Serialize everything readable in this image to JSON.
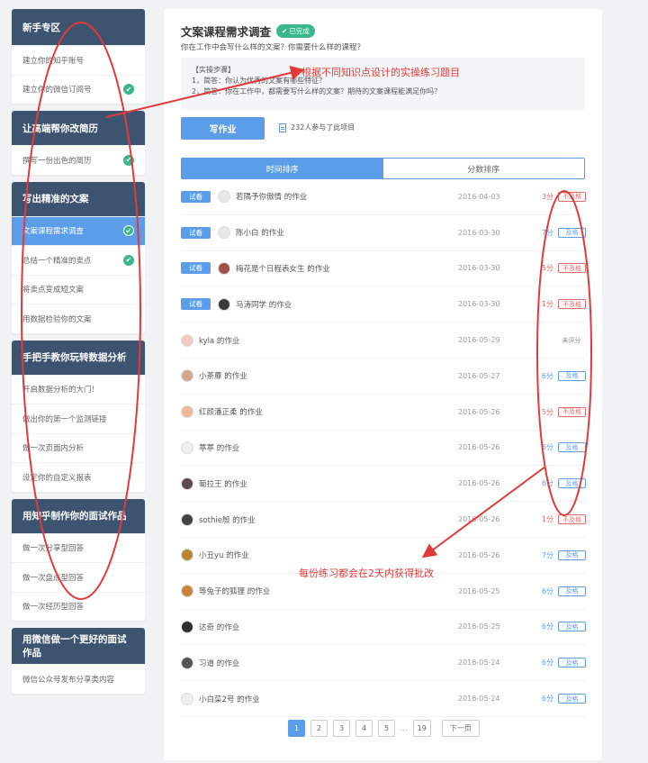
{
  "sidebar": [
    {
      "title": "新手专区",
      "items": [
        {
          "label": "建立你的知乎账号",
          "done": false
        },
        {
          "label": "建立你的微信订阅号",
          "done": true
        }
      ]
    },
    {
      "title": "让高端帮你改简历",
      "items": [
        {
          "label": "撰写一份出色的简历",
          "done": true
        }
      ]
    },
    {
      "title": "写出精准的文案",
      "items": [
        {
          "label": "文案课程需求调查",
          "done": true,
          "active": true
        },
        {
          "label": "总结一个精准的卖点",
          "done": true
        },
        {
          "label": "将卖点变成短文案",
          "done": false
        },
        {
          "label": "用数据检验你的文案",
          "done": false
        }
      ]
    },
    {
      "title": "手把手教你玩转数据分析",
      "items": [
        {
          "label": "开启数据分析的大门！",
          "done": false
        },
        {
          "label": "做出你的第一个监测链接",
          "done": false
        },
        {
          "label": "做一次页面内分析",
          "done": false
        },
        {
          "label": "设定你的自定义报表",
          "done": false
        }
      ]
    },
    {
      "title": "用知乎制作你的面试作品",
      "items": [
        {
          "label": "做一次分享型回答",
          "done": false
        },
        {
          "label": "做一次盘点型回答",
          "done": false
        },
        {
          "label": "做一次经历型回答",
          "done": false
        }
      ]
    },
    {
      "title": "用微信做一个更好的面试作品",
      "items": [
        {
          "label": "微信公众号发布分享类内容",
          "done": false
        }
      ]
    }
  ],
  "main": {
    "title": "文案课程需求调查",
    "badge": "已完成",
    "subtitle": "你在工作中会写什么样的文案？你需要什么样的课程？",
    "steps_heading": "【实操步骤】",
    "steps": [
      "1，简答：你认为优秀的文案有哪些特征？",
      "2，简答：你在工作中，都需要写什么样的文案？期待的文案课程能满足你吗？"
    ],
    "write_button": "写作业",
    "participants": "232人参与了此项目",
    "tabs": [
      "时间排序",
      "分数排序"
    ]
  },
  "rows": [
    {
      "trial": "试看",
      "name": "若隅予你傲情 的作业",
      "date": "2016-04-03",
      "score": "3分",
      "status": "不及格",
      "kind": "fail",
      "avatar": "#e8e8e8"
    },
    {
      "trial": "试看",
      "name": "陈小白 的作业",
      "date": "2016-03-30",
      "score": "7分",
      "status": "及格",
      "kind": "pass",
      "avatar": "#e8e8e8"
    },
    {
      "trial": "试看",
      "name": "梅花是个日程表女生 的作业",
      "date": "2016-03-30",
      "score": "5分",
      "status": "不及格",
      "kind": "fail",
      "avatar": "#a0524a"
    },
    {
      "trial": "试看",
      "name": "马涛同学 的作业",
      "date": "2016-03-30",
      "score": "1分",
      "status": "不及格",
      "kind": "fail",
      "avatar": "#3a3a3a"
    },
    {
      "trial": "",
      "name": "kyla 的作业",
      "date": "2016-05-29",
      "score": "",
      "status": "未评分",
      "kind": "none",
      "avatar": "#f3c9c4"
    },
    {
      "trial": "",
      "name": "小茶蘼 的作业",
      "date": "2016-05-27",
      "score": "6分",
      "status": "及格",
      "kind": "pass",
      "avatar": "#d4a88c"
    },
    {
      "trial": "",
      "name": "红颜潘正柔 的作业",
      "date": "2016-05-26",
      "score": "5分",
      "status": "不及格",
      "kind": "fail",
      "avatar": "#f0b89a"
    },
    {
      "trial": "",
      "name": "葶葶 的作业",
      "date": "2016-05-26",
      "score": "6分",
      "status": "及格",
      "kind": "pass",
      "avatar": "#eeeeee"
    },
    {
      "trial": "",
      "name": "葡拉王 的作业",
      "date": "2016-05-26",
      "score": "6分",
      "status": "及格",
      "kind": "pass",
      "avatar": "#5a4a4a"
    },
    {
      "trial": "",
      "name": "sothie殷 的作业",
      "date": "2016-05-26",
      "score": "1分",
      "status": "不及格",
      "kind": "fail",
      "avatar": "#444444"
    },
    {
      "trial": "",
      "name": "小丑yu 的作业",
      "date": "2016-05-26",
      "score": "7分",
      "status": "及格",
      "kind": "pass",
      "avatar": "#b8862c"
    },
    {
      "trial": "",
      "name": "等兔子的狐狸 的作业",
      "date": "2016-05-25",
      "score": "6分",
      "status": "及格",
      "kind": "pass",
      "avatar": "#c8803a"
    },
    {
      "trial": "",
      "name": "达奇 的作业",
      "date": "2016-05-25",
      "score": "6分",
      "status": "及格",
      "kind": "pass",
      "avatar": "#2e2e2e"
    },
    {
      "trial": "",
      "name": "习道 的作业",
      "date": "2016-05-24",
      "score": "6分",
      "status": "及格",
      "kind": "pass",
      "avatar": "#555555"
    },
    {
      "trial": "",
      "name": "小白菜2号 的作业",
      "date": "2016-05-24",
      "score": "6分",
      "status": "及格",
      "kind": "pass",
      "avatar": "#eeeeee"
    }
  ],
  "pager": {
    "pages": [
      "1",
      "2",
      "3",
      "4",
      "5"
    ],
    "ellipsis": "...",
    "last": "19",
    "next": "下一页"
  },
  "annotations": {
    "note1": "根据不同知识点设计的实操练习题目",
    "note2": "每份练习都会在2天内获得批改"
  },
  "colors": {
    "accent": "#5b9de8",
    "header": "#3d5470",
    "success": "#3bb889",
    "danger": "#e36a6a",
    "annotation": "#e23a3a"
  }
}
